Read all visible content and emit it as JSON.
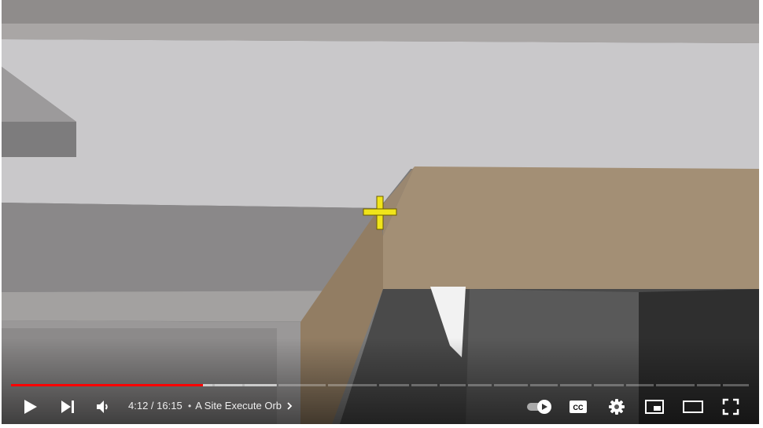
{
  "player": {
    "current_time": "4:12",
    "separator": " / ",
    "duration": "16:15",
    "chapter_title": "A Site Execute Orb",
    "chapter_bullet": "•",
    "progress": {
      "played_fraction": 0.26,
      "buffered_fraction": 0.36
    },
    "accent_color": "#ff0000",
    "icons": [
      "play-icon",
      "next-icon",
      "volume-icon",
      "chevron-right-icon",
      "autoplay-toggle-icon",
      "captions-icon",
      "settings-icon",
      "miniplayer-icon",
      "theater-mode-icon",
      "fullscreen-icon"
    ]
  }
}
